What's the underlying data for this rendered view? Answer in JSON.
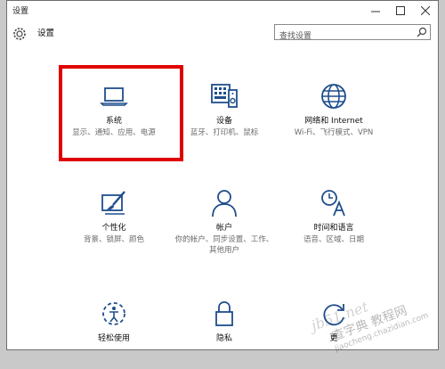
{
  "window": {
    "title": "设置"
  },
  "header": {
    "title": "设置",
    "search_placeholder": "查找设置"
  },
  "tiles": [
    {
      "name": "系统",
      "desc": "显示、通知、应用、电源",
      "icon": "laptop-icon"
    },
    {
      "name": "设备",
      "desc": "蓝牙、打印机、鼠标",
      "icon": "devices-icon"
    },
    {
      "name": "网络和 Internet",
      "desc": "Wi-Fi、飞行模式、VPN",
      "icon": "globe-icon"
    },
    {
      "name": "个性化",
      "desc": "背景、锁屏、颜色",
      "icon": "paint-icon"
    },
    {
      "name": "帐户",
      "desc": "你的帐户、同步设置、工作、其他用户",
      "icon": "person-icon"
    },
    {
      "name": "时间和语言",
      "desc": "语音、区域、日期",
      "icon": "time-language-icon"
    },
    {
      "name": "轻松使用",
      "desc": "",
      "icon": "ease-of-access-icon"
    },
    {
      "name": "隐私",
      "desc": "",
      "icon": "lock-icon"
    },
    {
      "name": "更",
      "desc": "",
      "icon": "update-icon"
    }
  ],
  "watermark": {
    "line1": "jb51.net",
    "line2": "查字典 教程网",
    "line3": "jiaocheng.chazidian.com"
  },
  "colors": {
    "accent": "#1f4e8c",
    "highlight": "#e00000"
  }
}
